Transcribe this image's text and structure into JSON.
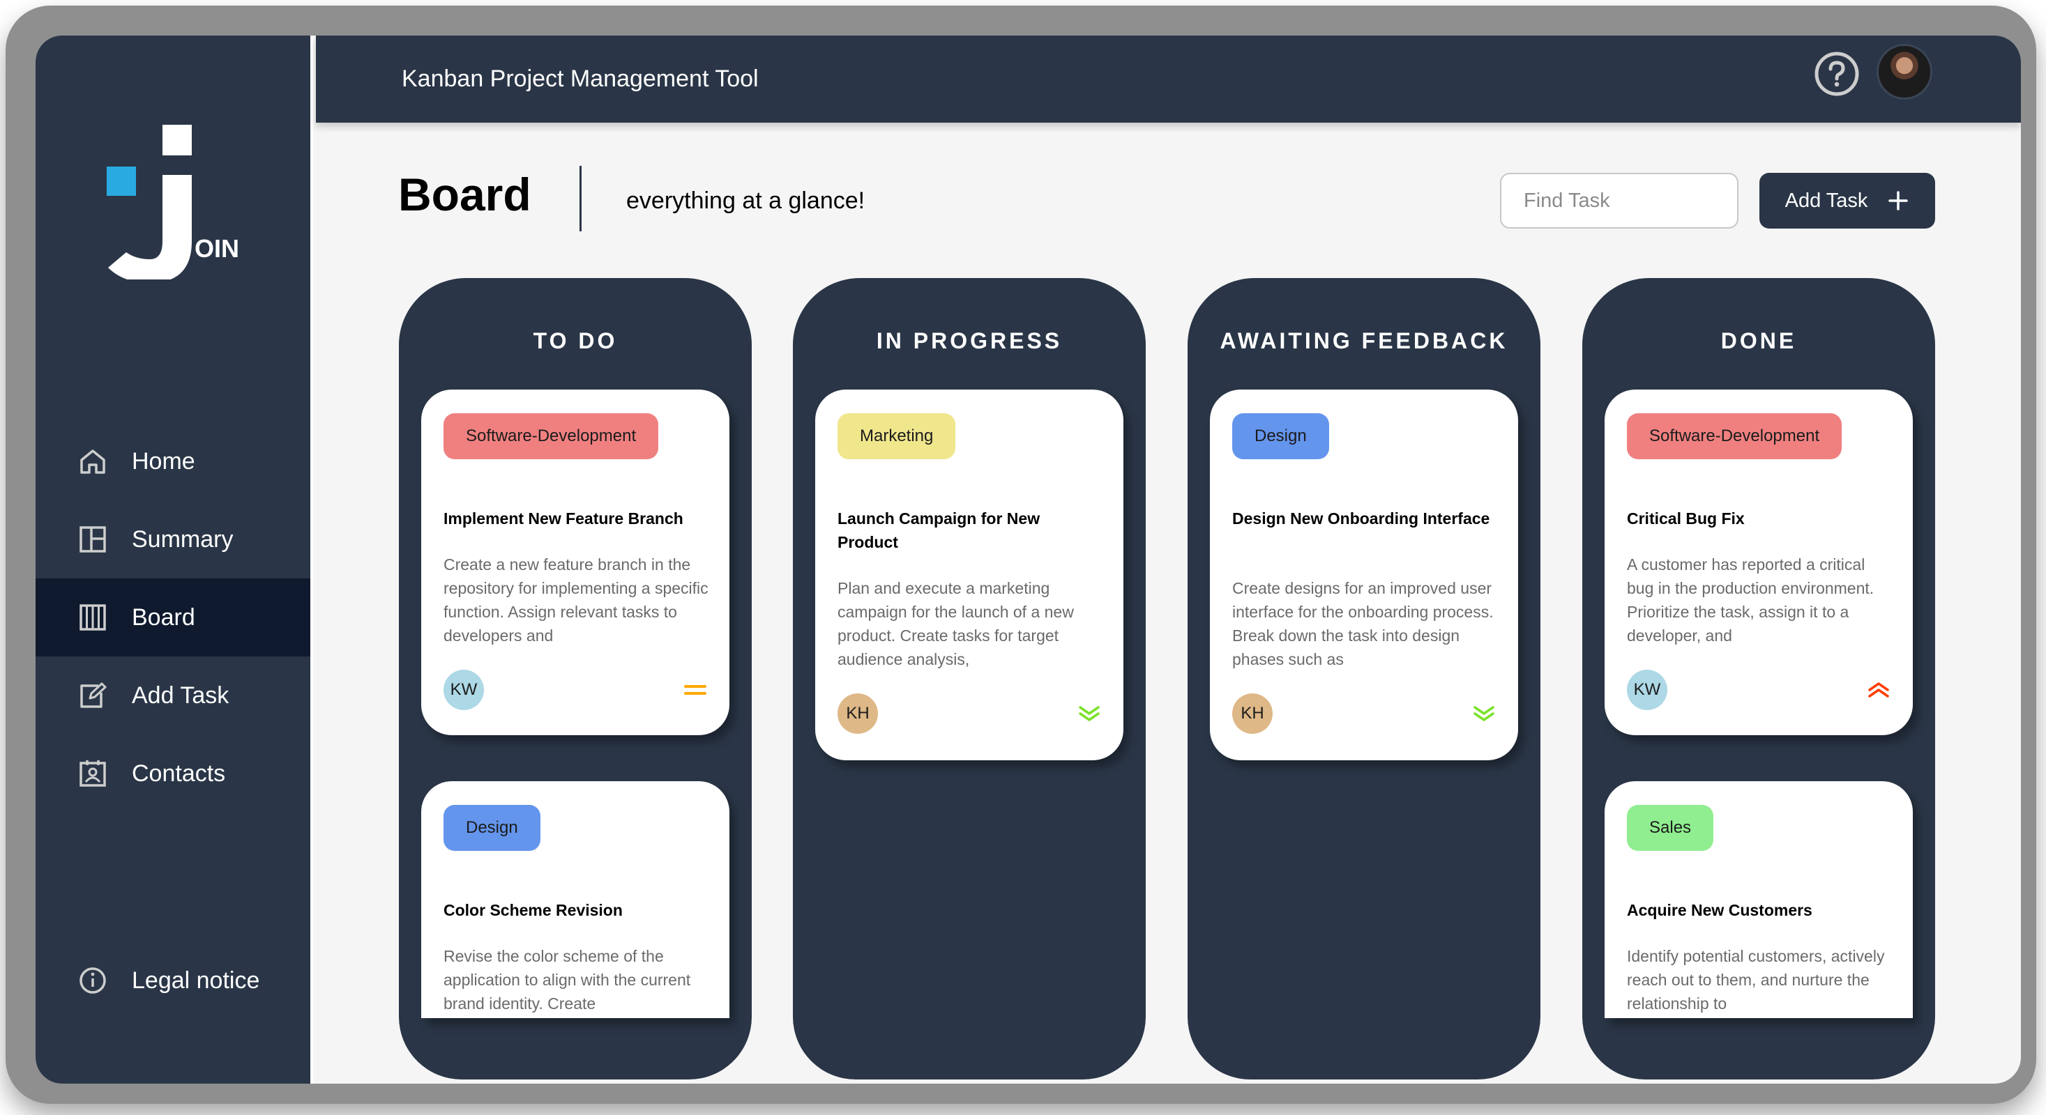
{
  "app": {
    "title": "Kanban Project Management Tool"
  },
  "logo": {
    "suffix": "OIN"
  },
  "sidebar": {
    "items": [
      {
        "label": "Home",
        "icon": "home-icon"
      },
      {
        "label": "Summary",
        "icon": "summary-icon"
      },
      {
        "label": "Board",
        "icon": "board-icon",
        "active": true
      },
      {
        "label": "Add Task",
        "icon": "add-task-icon"
      },
      {
        "label": "Contacts",
        "icon": "contacts-icon"
      }
    ],
    "legal": "Legal notice"
  },
  "header": {
    "help_icon": "question-circle-icon",
    "avatar": "user-avatar"
  },
  "board": {
    "title": "Board",
    "tagline": "everything at a glance!",
    "search_placeholder": "Find Task",
    "add_task_label": "Add Task"
  },
  "colors": {
    "sidebar": "#2a3647",
    "active_nav": "#0f1a2e",
    "tag_software": "#f08080",
    "tag_marketing": "#f0e68c",
    "tag_design": "#6495ed",
    "tag_sales": "#90ee90",
    "avatar_kw": "#add8e6",
    "avatar_kh": "#deb887",
    "prio_medium": "#ffa800",
    "prio_low": "#7ae229",
    "prio_urgent": "#ff3d00"
  },
  "columns": [
    {
      "title": "TO DO",
      "cards": [
        {
          "tag": "Software-Development",
          "title": "Implement New Feature Branch",
          "description": "Create a new feature branch in the repository for implementing a specific function. Assign relevant tasks to developers and",
          "assignee": "KW",
          "priority": "medium"
        },
        {
          "tag": "Design",
          "title": "Color Scheme Revision",
          "description": "Revise the color scheme of the application to align with the current brand identity. Create",
          "assignee": "",
          "priority": ""
        }
      ]
    },
    {
      "title": "IN PROGRESS",
      "cards": [
        {
          "tag": "Marketing",
          "title": "Launch Campaign for New Product",
          "description": "Plan and execute a marketing campaign for the launch of a new product. Create tasks for target audience analysis,",
          "assignee": "KH",
          "priority": "low"
        }
      ]
    },
    {
      "title": "AWAITING FEEDBACK",
      "cards": [
        {
          "tag": "Design",
          "title": "Design New Onboarding Interface",
          "description": "Create designs for an improved user interface for the onboarding process. Break down the task into design phases such as",
          "assignee": "KH",
          "priority": "low"
        }
      ]
    },
    {
      "title": "DONE",
      "cards": [
        {
          "tag": "Software-Development",
          "title": "Critical Bug Fix",
          "description": "A customer has reported a critical bug in the production environment. Prioritize the task, assign it to a developer, and",
          "assignee": "KW",
          "priority": "urgent"
        },
        {
          "tag": "Sales",
          "title": "Acquire New Customers",
          "description": "Identify potential customers, actively reach out to them, and nurture the relationship to",
          "assignee": "",
          "priority": ""
        }
      ]
    }
  ]
}
